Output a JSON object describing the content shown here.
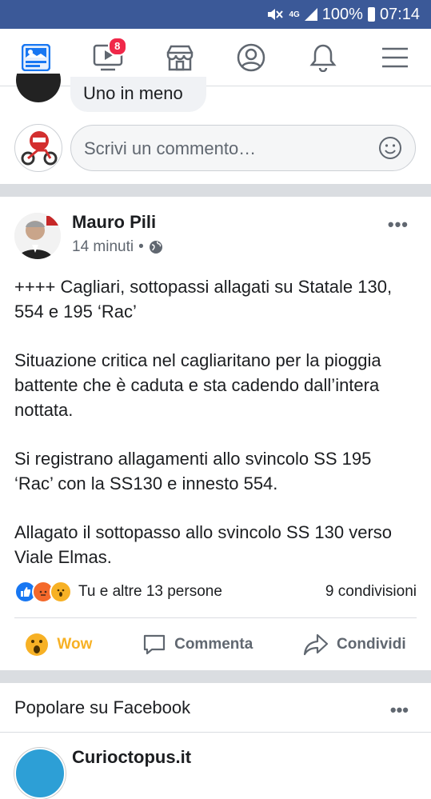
{
  "status_bar": {
    "network": "4G",
    "battery": "100%",
    "time": "07:14"
  },
  "nav": {
    "video_badge": "8",
    "icons": [
      "news-feed-icon",
      "video-icon",
      "marketplace-icon",
      "profile-icon",
      "notifications-icon",
      "menu-icon"
    ]
  },
  "previous_comment": {
    "text": "Uno in meno"
  },
  "composer": {
    "placeholder": "Scrivi un commento…"
  },
  "post": {
    "author": "Mauro Pili",
    "time": "14 minuti",
    "separator": "•",
    "paragraphs": [
      "++++ Cagliari, sottopassi allagati su Statale 130, 554 e 195 ‘Rac’",
      "Situazione critica nel cagliaritano per la pioggia battente che è caduta e sta cadendo dall’intera nottata.",
      "Si registrano allagamenti allo svincolo SS 195 ‘Rac’ con la SS130 e innesto 554.",
      "Allagato il sottopasso allo svincolo SS 130 verso Viale Elmas."
    ],
    "reactions_text": "Tu e altre 13 persone",
    "shares": "9 condivisioni",
    "actions": {
      "wow": "Wow",
      "comment": "Commenta",
      "share": "Condividi"
    }
  },
  "popular": {
    "title": "Popolare su Facebook",
    "next_page": "Curioctopus.it"
  },
  "colors": {
    "brand": "#3b5998",
    "wow": "#f7b125",
    "badge": "#f02849"
  }
}
